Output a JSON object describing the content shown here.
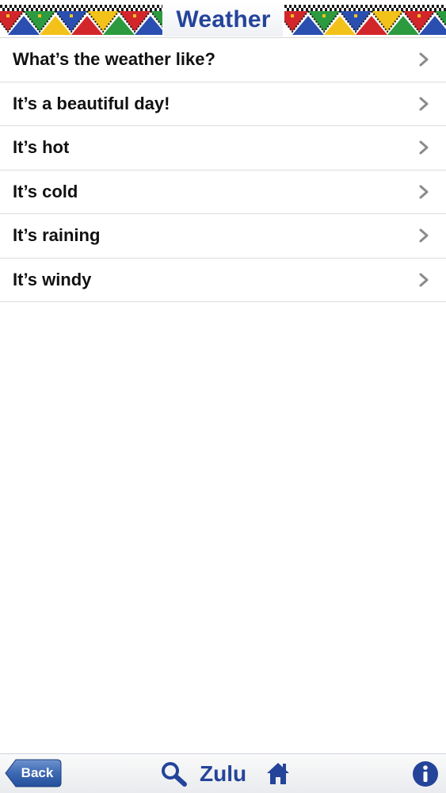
{
  "header": {
    "title": "Weather",
    "decoration": "zulu-beadwork-pattern"
  },
  "list": {
    "items": [
      {
        "label": "What’s the weather like?",
        "icon": "chevron-right-icon"
      },
      {
        "label": "It’s a beautiful day!",
        "icon": "chevron-right-icon"
      },
      {
        "label": "It’s hot",
        "icon": "chevron-right-icon"
      },
      {
        "label": "It’s cold",
        "icon": "chevron-right-icon"
      },
      {
        "label": "It’s raining",
        "icon": "chevron-right-icon"
      },
      {
        "label": "It’s windy",
        "icon": "chevron-right-icon"
      }
    ]
  },
  "toolbar": {
    "back_label": "Back",
    "language_label": "Zulu",
    "icons": [
      "search-icon",
      "home-icon",
      "info-icon"
    ]
  },
  "colors": {
    "title_blue": "#24449a",
    "back_button_blue": "#2a5aa6",
    "bead_red": "#d3262b",
    "bead_green": "#2c9a3f",
    "bead_yellow": "#f2c21a",
    "bead_blue": "#2a4fb0",
    "bead_black": "#1a1a1a"
  }
}
